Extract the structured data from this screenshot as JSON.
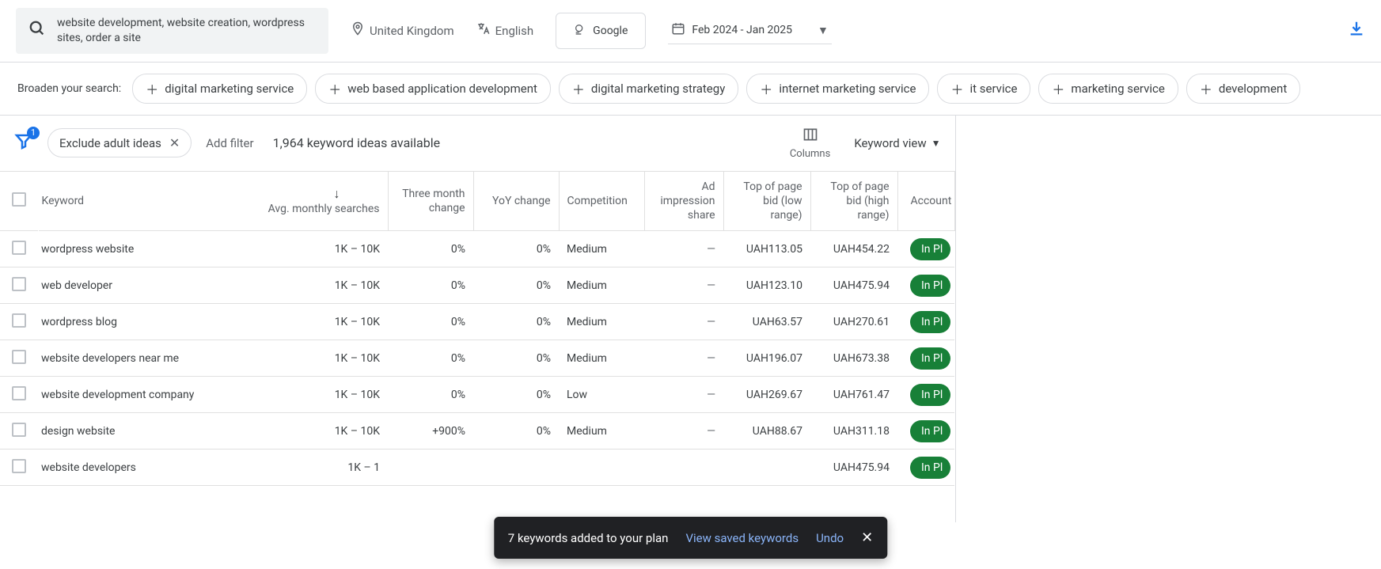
{
  "topbar": {
    "search_text": "website development, website creation, wordpress sites, order a site",
    "location": "United Kingdom",
    "language": "English",
    "network": "Google",
    "date_range": "Feb 2024 - Jan 2025"
  },
  "broaden": {
    "label": "Broaden your search:",
    "suggestions": [
      "digital marketing service",
      "web based application development",
      "digital marketing strategy",
      "internet marketing service",
      "it service",
      "marketing service",
      "development"
    ]
  },
  "filters": {
    "badge": "1",
    "exclude_label": "Exclude adult ideas",
    "add_filter": "Add filter",
    "ideas_count": "1,964 keyword ideas available",
    "columns_label": "Columns",
    "view_label": "Keyword view"
  },
  "columns": {
    "keyword": "Keyword",
    "avg": "Avg. monthly searches",
    "three_month": "Three month change",
    "yoy": "YoY change",
    "competition": "Competition",
    "ad_impression": "Ad impression share",
    "low_bid": "Top of page bid (low range)",
    "high_bid": "Top of page bid (high range)",
    "account": "Account"
  },
  "rows": [
    {
      "keyword": "wordpress website",
      "avg": "1K – 10K",
      "three_month": "0%",
      "yoy": "0%",
      "competition": "Medium",
      "ad_impression": "—",
      "low_bid": "UAH113.05",
      "high_bid": "UAH454.22",
      "status": "In Pl"
    },
    {
      "keyword": "web developer",
      "avg": "1K – 10K",
      "three_month": "0%",
      "yoy": "0%",
      "competition": "Medium",
      "ad_impression": "—",
      "low_bid": "UAH123.10",
      "high_bid": "UAH475.94",
      "status": "In Pl"
    },
    {
      "keyword": "wordpress blog",
      "avg": "1K – 10K",
      "three_month": "0%",
      "yoy": "0%",
      "competition": "Medium",
      "ad_impression": "—",
      "low_bid": "UAH63.57",
      "high_bid": "UAH270.61",
      "status": "In Pl"
    },
    {
      "keyword": "website developers near me",
      "avg": "1K – 10K",
      "three_month": "0%",
      "yoy": "0%",
      "competition": "Medium",
      "ad_impression": "—",
      "low_bid": "UAH196.07",
      "high_bid": "UAH673.38",
      "status": "In Pl"
    },
    {
      "keyword": "website development company",
      "avg": "1K – 10K",
      "three_month": "0%",
      "yoy": "0%",
      "competition": "Low",
      "ad_impression": "—",
      "low_bid": "UAH269.67",
      "high_bid": "UAH761.47",
      "status": "In Pl"
    },
    {
      "keyword": "design website",
      "avg": "1K – 10K",
      "three_month": "+900%",
      "yoy": "0%",
      "competition": "Medium",
      "ad_impression": "—",
      "low_bid": "UAH88.67",
      "high_bid": "UAH311.18",
      "status": "In Pl"
    },
    {
      "keyword": "website developers",
      "avg": "1K – 1",
      "three_month": "",
      "yoy": "",
      "competition": "",
      "ad_impression": "",
      "low_bid": "",
      "high_bid": "UAH475.94",
      "status": "In Pl"
    }
  ],
  "toast": {
    "message": "7 keywords added to your plan",
    "link1": "View saved keywords",
    "link2": "Undo"
  }
}
